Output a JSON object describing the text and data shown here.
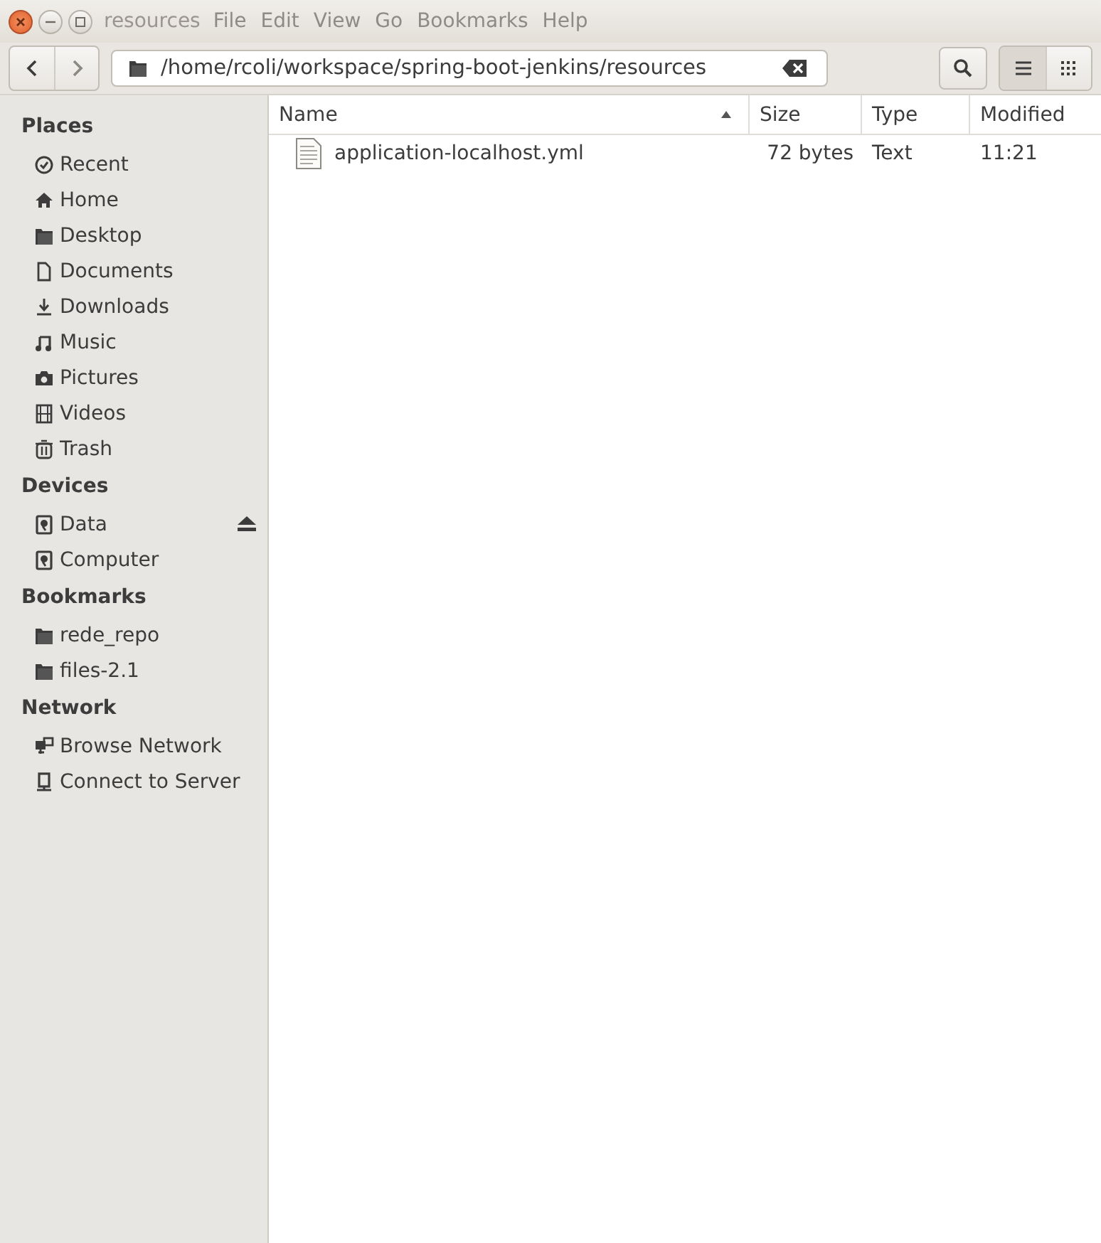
{
  "window": {
    "title": "resources"
  },
  "menu": [
    "File",
    "Edit",
    "View",
    "Go",
    "Bookmarks",
    "Help"
  ],
  "location": {
    "value": "/home/rcoli/workspace/spring-boot-jenkins/resources"
  },
  "view_buttons": [
    {
      "kind": "list",
      "selected": true
    },
    {
      "kind": "grid",
      "selected": false
    }
  ],
  "sidebar": [
    {
      "heading": "Places",
      "items": [
        {
          "label": "Recent",
          "kind": "recent"
        },
        {
          "label": "Home",
          "kind": "home"
        },
        {
          "label": "Desktop",
          "kind": "folder"
        },
        {
          "label": "Documents",
          "kind": "document"
        },
        {
          "label": "Downloads",
          "kind": "download"
        },
        {
          "label": "Music",
          "kind": "music"
        },
        {
          "label": "Pictures",
          "kind": "camera"
        },
        {
          "label": "Videos",
          "kind": "film"
        },
        {
          "label": "Trash",
          "kind": "trash"
        }
      ]
    },
    {
      "heading": "Devices",
      "items": [
        {
          "label": "Data",
          "kind": "drive",
          "ejectable": true
        },
        {
          "label": "Computer",
          "kind": "drive",
          "ejectable": false
        }
      ]
    },
    {
      "heading": "Bookmarks",
      "items": [
        {
          "label": "rede_repo",
          "kind": "folder"
        },
        {
          "label": "files-2.1",
          "kind": "folder"
        }
      ]
    },
    {
      "heading": "Network",
      "items": [
        {
          "label": "Browse Network",
          "kind": "network"
        },
        {
          "label": "Connect to Server",
          "kind": "server"
        }
      ]
    }
  ],
  "table": {
    "columns": [
      {
        "label": "Name",
        "sorted": true
      },
      {
        "label": "Size",
        "sorted": false
      },
      {
        "label": "Type",
        "sorted": false
      },
      {
        "label": "Modified",
        "sorted": false
      }
    ],
    "rows": [
      {
        "name": "application-localhost.yml",
        "size": "72 bytes",
        "type": "Text",
        "modified": "11:21",
        "selected": false
      }
    ]
  }
}
